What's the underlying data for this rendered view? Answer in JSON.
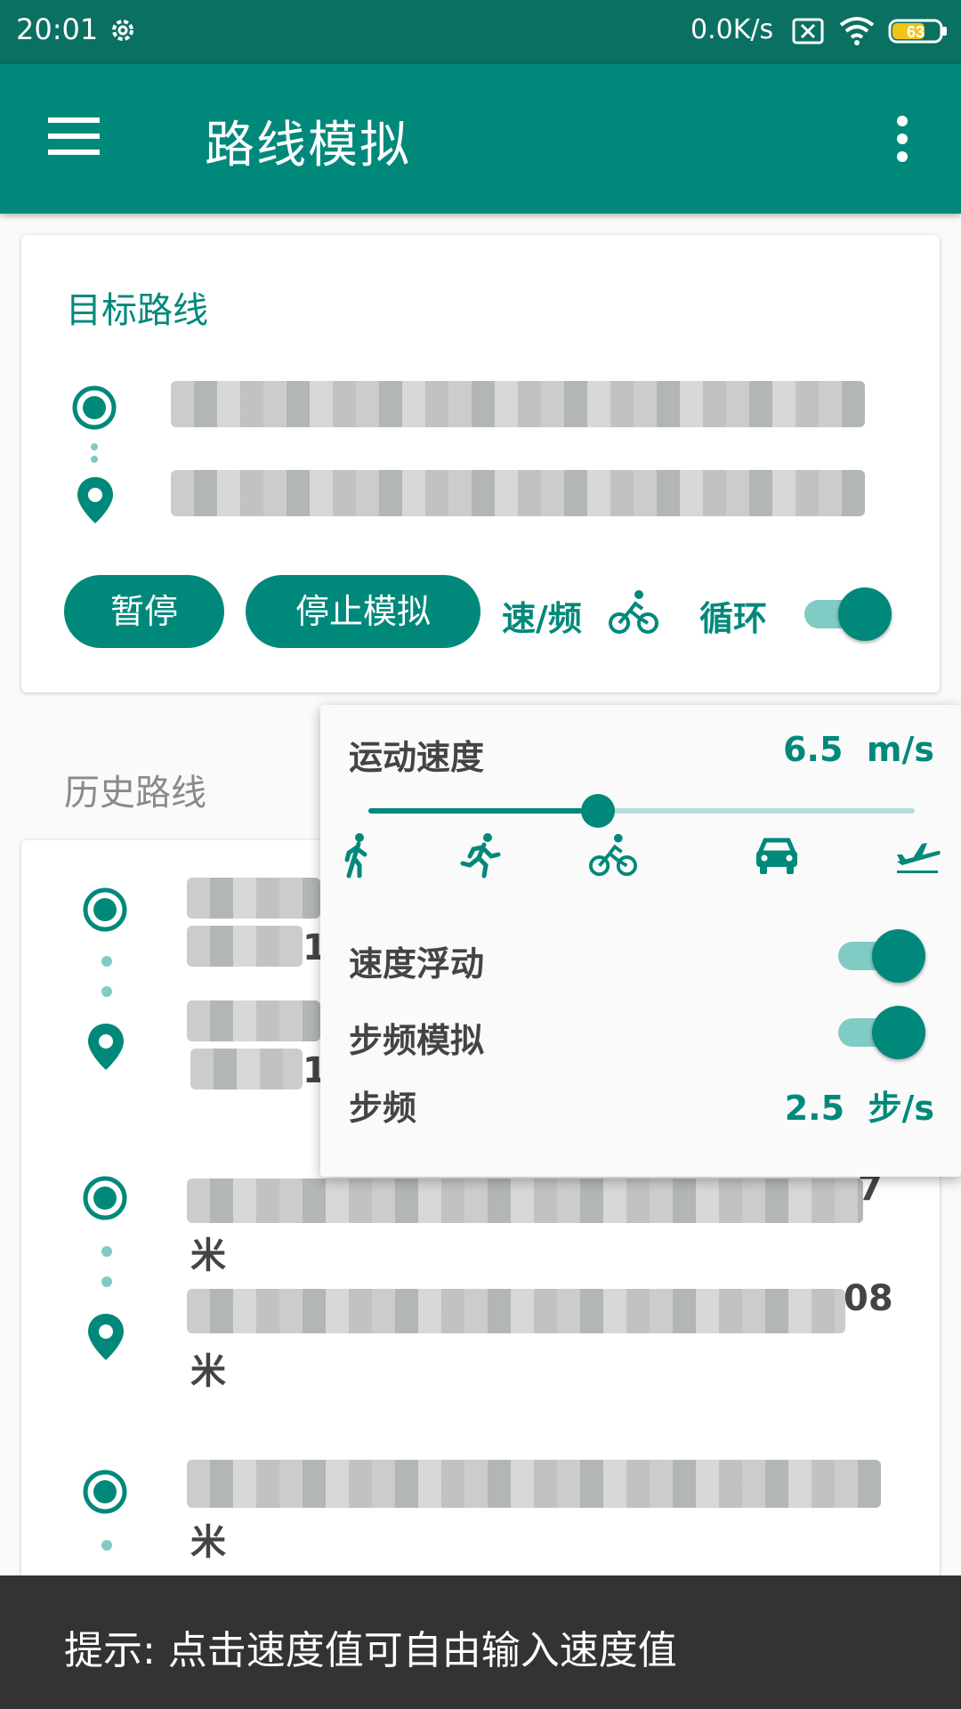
{
  "status_bar": {
    "time": "20:01",
    "net_speed": "0.0K/s",
    "battery": "63",
    "icons": [
      "gear-icon",
      "no-sim-icon",
      "wifi-icon",
      "battery-icon"
    ]
  },
  "app_bar": {
    "title": "路线模拟",
    "icons": [
      "menu-icon",
      "more-vert-icon"
    ]
  },
  "target_card": {
    "label": "目标路线",
    "pause_label": "暂停",
    "stop_label": "停止模拟",
    "speed_freq_label": "速/频",
    "loop_label": "循环",
    "loop_enabled": true
  },
  "history": {
    "label": "历史路线",
    "unit_mi": "米",
    "partial_digit": "1",
    "partial_digit2": "7",
    "partial_digit3": "08"
  },
  "speed_popup": {
    "speed_label": "运动速度",
    "speed_value": "6.5",
    "speed_unit": "m/s",
    "slider_fraction": 0.42,
    "modes": [
      "walk-icon",
      "run-icon",
      "bike-icon",
      "car-icon",
      "plane-icon"
    ],
    "float_label": "速度浮动",
    "float_enabled": true,
    "cadence_sim_label": "步频模拟",
    "cadence_sim_enabled": true,
    "cadence_label": "步频",
    "cadence_value": "2.5",
    "cadence_unit": "步/s"
  },
  "toast": {
    "text": "提示: 点击速度值可自由输入速度值"
  },
  "colors": {
    "primary": "#00897b",
    "primary_dark": "#0a7062",
    "primary_light": "#80cbc4"
  }
}
